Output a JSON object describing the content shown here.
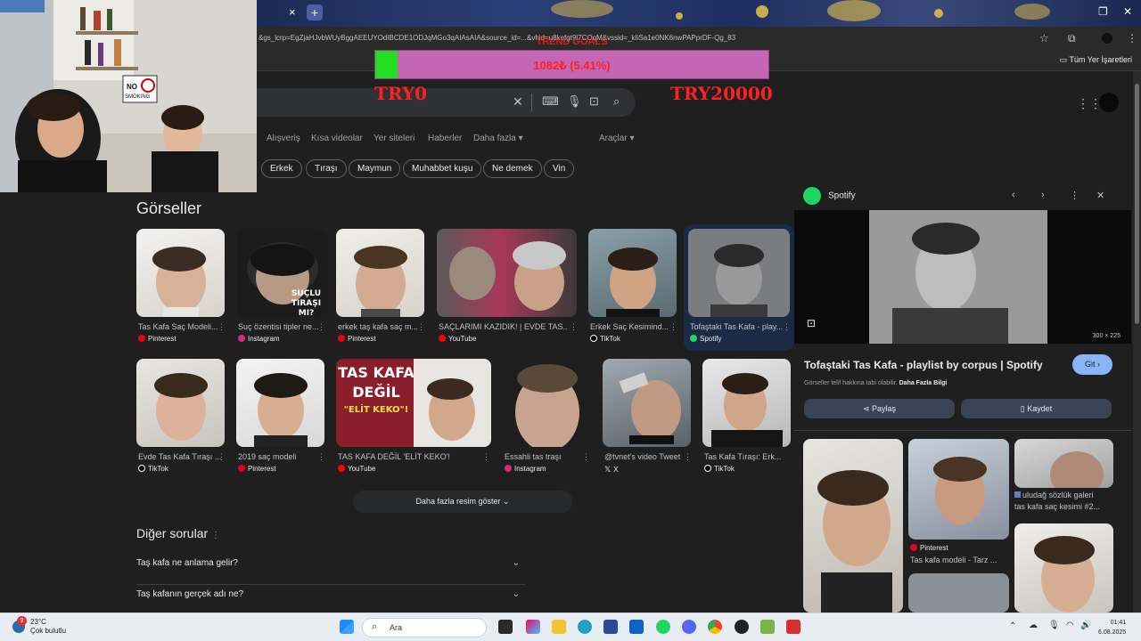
{
  "browser": {
    "tab_close": "×",
    "new_tab": "+",
    "url": "&gs_lcrp=EgZjaHJvbWUyBggAEEUYOdIBCDE1ODJqMGo3qAIAsAIA&source_id=...&vhid=u8kefgt9l7COqM&vssid=_kIiSa1e0NK6nwPAPprDF-Qg_83",
    "bookmarks_all": "Tüm Yer İşaretleri"
  },
  "donation": {
    "label": "1082₺ (5.41%)",
    "progress_percent": 5.41,
    "top_text": "TREND GOALS",
    "min_label": "TRY0",
    "max_label": "TRY20000"
  },
  "search": {
    "clear_icon": "close-icon",
    "keyboard_icon": "keyboard-icon",
    "mic_icon": "mic-icon",
    "lens_icon": "lens-icon",
    "search_icon": "search-icon"
  },
  "nav": {
    "items": [
      "Alışveriş",
      "Kısa videolar",
      "Yer siteleri",
      "Haberler",
      "Daha fazla"
    ],
    "tools": "Araçlar"
  },
  "chips": [
    "Erkek",
    "Tıraşı",
    "Maymun",
    "Muhabbet kuşu",
    "Ne demek",
    "Vin"
  ],
  "images_section": {
    "title": "Görseller",
    "row1": [
      {
        "caption": "Tas Kafa Saç Modeli...",
        "source": "Pinterest",
        "src_color": "#e60023"
      },
      {
        "caption": "Suç özentisi tipler ne...",
        "source": "Instagram",
        "src_color": "#d62976",
        "overlay": "SUÇLU TIRAŞI MI?"
      },
      {
        "caption": "erkek taş kafa saç m...",
        "source": "Pinterest",
        "src_color": "#e60023"
      },
      {
        "caption": "SAÇLARIMI KAZIDIK! | EVDE TAS...",
        "source": "YouTube",
        "src_color": "#ff0000"
      },
      {
        "caption": "Erkek Saç Kesimind...",
        "source": "TikTok",
        "src_color": "#000000"
      },
      {
        "caption": "Tofaştaki Tas Kafa - play...",
        "source": "Spotify",
        "src_color": "#1ed760"
      }
    ],
    "row2": [
      {
        "caption": "Evde Tas Kafa Tıraşı ...",
        "source": "TikTok",
        "src_color": "#000000"
      },
      {
        "caption": "2019 saç modeli",
        "source": "Pinterest",
        "src_color": "#e60023"
      },
      {
        "caption": "TAS KAFA DEĞİL 'ELİT KEKO'!",
        "source": "YouTube",
        "src_color": "#ff0000",
        "overlay1": "TAS KAFA",
        "overlay2": "DEĞİL",
        "overlay3": "\"ELİT KEKO\"!"
      },
      {
        "caption": "Essahli tas traşı",
        "source": "Instagram",
        "src_color": "#d62976"
      },
      {
        "caption": "@tvnet's video Tweet",
        "source": "X",
        "src_color": "#000000"
      },
      {
        "caption": "Tas Kafa Tıraşı: Erk...",
        "source": "TikTok",
        "src_color": "#000000"
      }
    ],
    "show_more": "Daha fazla resim göster"
  },
  "questions": {
    "title": "Diğer sorular",
    "items": [
      "Taş kafa ne anlama gelir?",
      "Taş kafanın gerçek adı ne?"
    ]
  },
  "panel": {
    "source": "Spotify",
    "size": "300 × 225",
    "title": "Tofaştaki Tas Kafa - playlist by corpus | Spotify",
    "go": "Git",
    "copyright": "Görseller telif hakkına tabi olabilir.",
    "copyright_link": "Daha Fazla Bilgi",
    "share": "Paylaş",
    "save": "Kaydet",
    "related": [
      {
        "caption": "uludağ sözlük galeri",
        "caption2": "tas kafa saç kesimi #2..."
      },
      {
        "source": "Pinterest",
        "caption": "Tas kafa modeli - Tarz ..."
      }
    ]
  },
  "taskbar": {
    "weather_temp": "23°C",
    "weather_desc": "Çok bulutlu",
    "notification_count": "9",
    "search_placeholder": "Ara",
    "time": "01:41",
    "date": "6.08.2025"
  },
  "webcam": {
    "sign": "NO SMOKING"
  }
}
